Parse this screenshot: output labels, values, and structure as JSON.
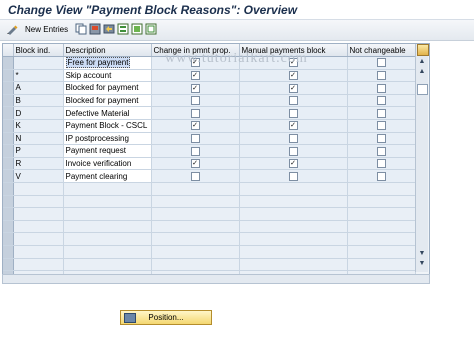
{
  "window": {
    "title": "Change View \"Payment Block Reasons\": Overview"
  },
  "toolbar": {
    "new_entries_label": "New Entries"
  },
  "watermark": "www.tutorialkart.com",
  "table": {
    "columns": [
      "Block ind.",
      "Description",
      "Change in pmnt prop.",
      "Manual payments block",
      "Not changeable"
    ],
    "rows": [
      {
        "code": "",
        "description": "Free for payment",
        "change": true,
        "manual": true,
        "notchg": false
      },
      {
        "code": "*",
        "description": "Skip account",
        "change": true,
        "manual": true,
        "notchg": false
      },
      {
        "code": "A",
        "description": "Blocked for payment",
        "change": true,
        "manual": true,
        "notchg": false
      },
      {
        "code": "B",
        "description": "Blocked for payment",
        "change": false,
        "manual": false,
        "notchg": false
      },
      {
        "code": "D",
        "description": "Defective Material",
        "change": false,
        "manual": false,
        "notchg": false
      },
      {
        "code": "K",
        "description": "Payment Block - CSCL",
        "change": true,
        "manual": true,
        "notchg": false
      },
      {
        "code": "N",
        "description": "IP postprocessing",
        "change": false,
        "manual": false,
        "notchg": false
      },
      {
        "code": "P",
        "description": "Payment request",
        "change": false,
        "manual": false,
        "notchg": false
      },
      {
        "code": "R",
        "description": "Invoice verification",
        "change": true,
        "manual": true,
        "notchg": false
      },
      {
        "code": "V",
        "description": "Payment clearing",
        "change": false,
        "manual": false,
        "notchg": false
      }
    ],
    "empty_rows": 8
  },
  "position_button": {
    "label": "Position..."
  }
}
